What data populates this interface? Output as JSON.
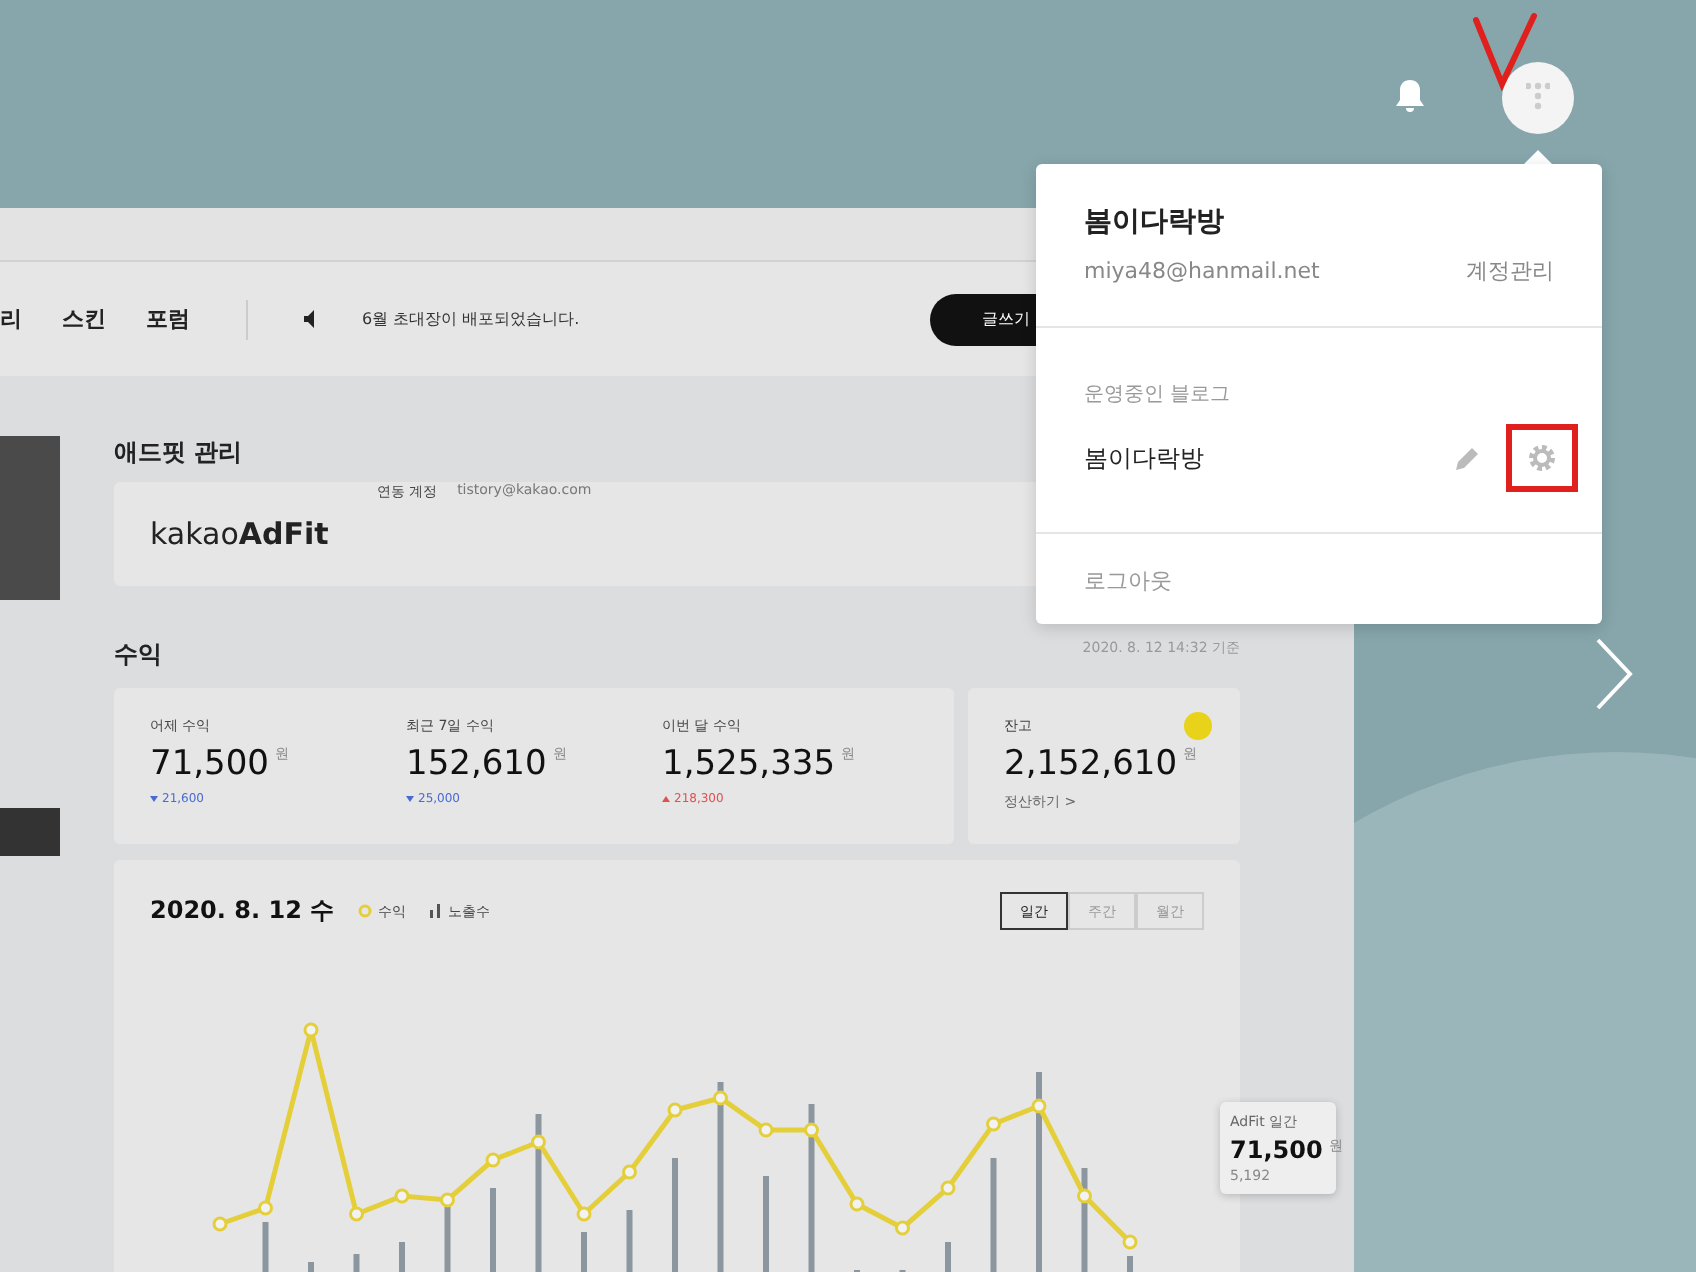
{
  "dashboard": {
    "nav": [
      "리",
      "스킨",
      "포럼"
    ],
    "notice": "6월 초대장이 배포되었습니다.",
    "write_button": "글쓰기",
    "adfit": {
      "title": "애드핏 관리",
      "logo_light": "kakao",
      "logo_bold": "AdFit",
      "account_label": "연동 계정",
      "account": "tistory@kakao.com"
    },
    "revenue": {
      "title": "수익",
      "timestamp": "2020. 8. 12 14:32 기준",
      "stats": [
        {
          "label": "어제 수익",
          "value": "71,500",
          "unit": "원",
          "change": "21,600",
          "rising": false
        },
        {
          "label": "최근 7일 수익",
          "value": "152,610",
          "unit": "원",
          "change": "25,000",
          "rising": false
        },
        {
          "label": "이번 달 수익",
          "value": "1,525,335",
          "unit": "원",
          "change": "218,300",
          "rising": true
        }
      ],
      "balance": {
        "label": "잔고",
        "value": "2,152,610",
        "unit": "원",
        "link": "정산하기 >"
      }
    },
    "chart": {
      "date": "2020. 8. 12 수",
      "legend": [
        {
          "label": "수익",
          "kind": "line"
        },
        {
          "label": "노출수",
          "kind": "bar"
        }
      ],
      "periods": [
        {
          "label": "일간",
          "selected": true
        },
        {
          "label": "주간",
          "selected": false
        },
        {
          "label": "월간",
          "selected": false
        }
      ],
      "tooltip": {
        "title": "AdFit 일간",
        "value": "71,500",
        "unit": "원",
        "impressions": "5,192"
      }
    }
  },
  "popup": {
    "name": "봄이다락방",
    "email": "miya48@hanmail.net",
    "account_link": "계정관리",
    "section_title": "운영중인 블로그",
    "blogs": [
      {
        "name": "봄이다락방"
      }
    ],
    "logout": "로그아웃"
  }
}
